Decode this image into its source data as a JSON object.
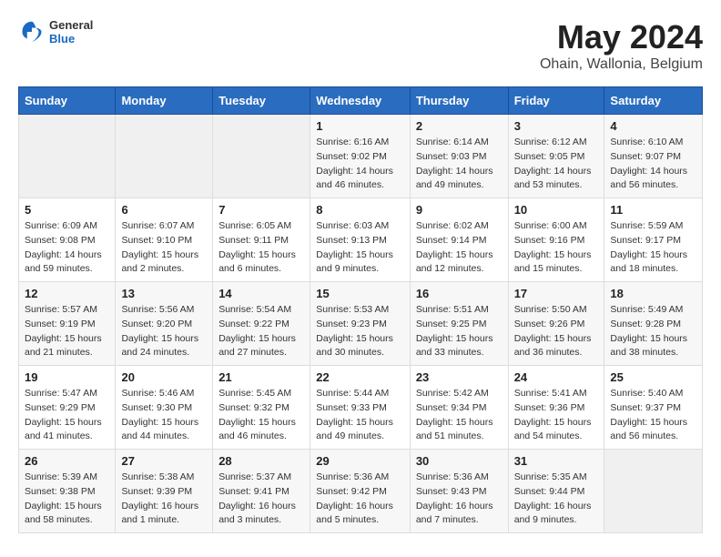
{
  "header": {
    "logo_general": "General",
    "logo_blue": "Blue",
    "month_title": "May 2024",
    "location": "Ohain, Wallonia, Belgium"
  },
  "days_of_week": [
    "Sunday",
    "Monday",
    "Tuesday",
    "Wednesday",
    "Thursday",
    "Friday",
    "Saturday"
  ],
  "weeks": [
    [
      {
        "day": "",
        "info": ""
      },
      {
        "day": "",
        "info": ""
      },
      {
        "day": "",
        "info": ""
      },
      {
        "day": "1",
        "info": "Sunrise: 6:16 AM\nSunset: 9:02 PM\nDaylight: 14 hours and 46 minutes."
      },
      {
        "day": "2",
        "info": "Sunrise: 6:14 AM\nSunset: 9:03 PM\nDaylight: 14 hours and 49 minutes."
      },
      {
        "day": "3",
        "info": "Sunrise: 6:12 AM\nSunset: 9:05 PM\nDaylight: 14 hours and 53 minutes."
      },
      {
        "day": "4",
        "info": "Sunrise: 6:10 AM\nSunset: 9:07 PM\nDaylight: 14 hours and 56 minutes."
      }
    ],
    [
      {
        "day": "5",
        "info": "Sunrise: 6:09 AM\nSunset: 9:08 PM\nDaylight: 14 hours and 59 minutes."
      },
      {
        "day": "6",
        "info": "Sunrise: 6:07 AM\nSunset: 9:10 PM\nDaylight: 15 hours and 2 minutes."
      },
      {
        "day": "7",
        "info": "Sunrise: 6:05 AM\nSunset: 9:11 PM\nDaylight: 15 hours and 6 minutes."
      },
      {
        "day": "8",
        "info": "Sunrise: 6:03 AM\nSunset: 9:13 PM\nDaylight: 15 hours and 9 minutes."
      },
      {
        "day": "9",
        "info": "Sunrise: 6:02 AM\nSunset: 9:14 PM\nDaylight: 15 hours and 12 minutes."
      },
      {
        "day": "10",
        "info": "Sunrise: 6:00 AM\nSunset: 9:16 PM\nDaylight: 15 hours and 15 minutes."
      },
      {
        "day": "11",
        "info": "Sunrise: 5:59 AM\nSunset: 9:17 PM\nDaylight: 15 hours and 18 minutes."
      }
    ],
    [
      {
        "day": "12",
        "info": "Sunrise: 5:57 AM\nSunset: 9:19 PM\nDaylight: 15 hours and 21 minutes."
      },
      {
        "day": "13",
        "info": "Sunrise: 5:56 AM\nSunset: 9:20 PM\nDaylight: 15 hours and 24 minutes."
      },
      {
        "day": "14",
        "info": "Sunrise: 5:54 AM\nSunset: 9:22 PM\nDaylight: 15 hours and 27 minutes."
      },
      {
        "day": "15",
        "info": "Sunrise: 5:53 AM\nSunset: 9:23 PM\nDaylight: 15 hours and 30 minutes."
      },
      {
        "day": "16",
        "info": "Sunrise: 5:51 AM\nSunset: 9:25 PM\nDaylight: 15 hours and 33 minutes."
      },
      {
        "day": "17",
        "info": "Sunrise: 5:50 AM\nSunset: 9:26 PM\nDaylight: 15 hours and 36 minutes."
      },
      {
        "day": "18",
        "info": "Sunrise: 5:49 AM\nSunset: 9:28 PM\nDaylight: 15 hours and 38 minutes."
      }
    ],
    [
      {
        "day": "19",
        "info": "Sunrise: 5:47 AM\nSunset: 9:29 PM\nDaylight: 15 hours and 41 minutes."
      },
      {
        "day": "20",
        "info": "Sunrise: 5:46 AM\nSunset: 9:30 PM\nDaylight: 15 hours and 44 minutes."
      },
      {
        "day": "21",
        "info": "Sunrise: 5:45 AM\nSunset: 9:32 PM\nDaylight: 15 hours and 46 minutes."
      },
      {
        "day": "22",
        "info": "Sunrise: 5:44 AM\nSunset: 9:33 PM\nDaylight: 15 hours and 49 minutes."
      },
      {
        "day": "23",
        "info": "Sunrise: 5:42 AM\nSunset: 9:34 PM\nDaylight: 15 hours and 51 minutes."
      },
      {
        "day": "24",
        "info": "Sunrise: 5:41 AM\nSunset: 9:36 PM\nDaylight: 15 hours and 54 minutes."
      },
      {
        "day": "25",
        "info": "Sunrise: 5:40 AM\nSunset: 9:37 PM\nDaylight: 15 hours and 56 minutes."
      }
    ],
    [
      {
        "day": "26",
        "info": "Sunrise: 5:39 AM\nSunset: 9:38 PM\nDaylight: 15 hours and 58 minutes."
      },
      {
        "day": "27",
        "info": "Sunrise: 5:38 AM\nSunset: 9:39 PM\nDaylight: 16 hours and 1 minute."
      },
      {
        "day": "28",
        "info": "Sunrise: 5:37 AM\nSunset: 9:41 PM\nDaylight: 16 hours and 3 minutes."
      },
      {
        "day": "29",
        "info": "Sunrise: 5:36 AM\nSunset: 9:42 PM\nDaylight: 16 hours and 5 minutes."
      },
      {
        "day": "30",
        "info": "Sunrise: 5:36 AM\nSunset: 9:43 PM\nDaylight: 16 hours and 7 minutes."
      },
      {
        "day": "31",
        "info": "Sunrise: 5:35 AM\nSunset: 9:44 PM\nDaylight: 16 hours and 9 minutes."
      },
      {
        "day": "",
        "info": ""
      }
    ]
  ]
}
